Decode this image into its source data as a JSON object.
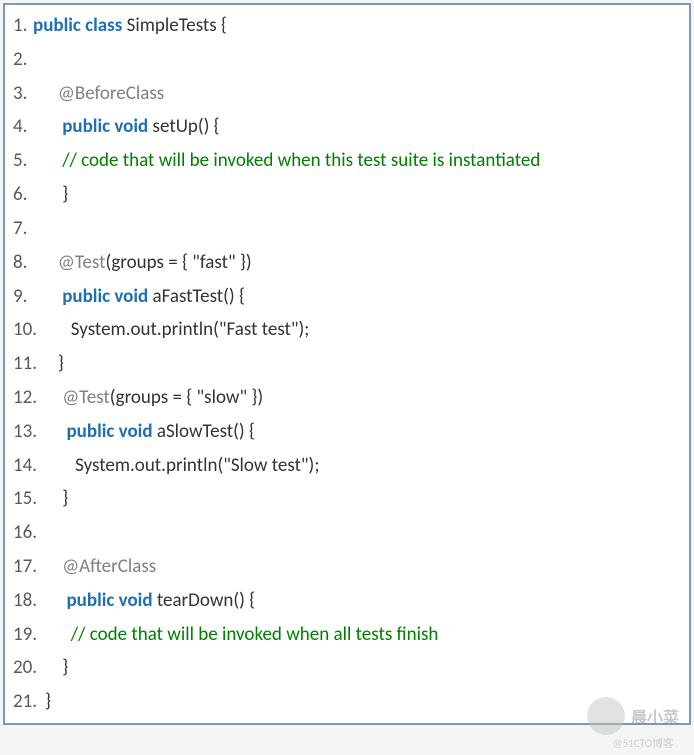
{
  "lines": [
    {
      "n": "1.",
      "indent": "",
      "segments": [
        {
          "t": "public class",
          "c": "kw"
        },
        {
          "t": " ",
          "c": "plain"
        },
        {
          "t": "SimpleTests {",
          "c": "cls"
        }
      ]
    },
    {
      "n": "2.",
      "indent": "",
      "segments": []
    },
    {
      "n": "3.",
      "indent": "   ",
      "segments": [
        {
          "t": "@BeforeClass",
          "c": "ann"
        }
      ]
    },
    {
      "n": "4.",
      "indent": "    ",
      "segments": [
        {
          "t": "public void",
          "c": "kw"
        },
        {
          "t": " setUp() {",
          "c": "plain"
        }
      ]
    },
    {
      "n": "5.",
      "indent": "    ",
      "segments": [
        {
          "t": "// code that will be invoked when this test suite is instantiated",
          "c": "comment"
        }
      ]
    },
    {
      "n": "6.",
      "indent": "    ",
      "segments": [
        {
          "t": "}",
          "c": "plain"
        }
      ]
    },
    {
      "n": "7.",
      "indent": "",
      "segments": []
    },
    {
      "n": "8.",
      "indent": "   ",
      "segments": [
        {
          "t": "@Test",
          "c": "ann"
        },
        {
          "t": "(groups = { \"fast\" })",
          "c": "plain"
        }
      ]
    },
    {
      "n": "9.",
      "indent": "    ",
      "segments": [
        {
          "t": "public void",
          "c": "kw"
        },
        {
          "t": " aFastTest() {",
          "c": "plain"
        }
      ]
    },
    {
      "n": "10.",
      "indent": "      ",
      "segments": [
        {
          "t": "System.out.println(\"Fast test\");",
          "c": "plain"
        }
      ]
    },
    {
      "n": "11.",
      "indent": "   ",
      "segments": [
        {
          "t": "}",
          "c": "plain"
        }
      ]
    },
    {
      "n": "12.",
      "indent": "    ",
      "segments": [
        {
          "t": "@Test",
          "c": "ann"
        },
        {
          "t": "(groups = { \"slow\" })",
          "c": "plain"
        }
      ]
    },
    {
      "n": "13.",
      "indent": "     ",
      "segments": [
        {
          "t": "public void",
          "c": "kw"
        },
        {
          "t": " aSlowTest() {",
          "c": "plain"
        }
      ]
    },
    {
      "n": "14.",
      "indent": "       ",
      "segments": [
        {
          "t": "System.out.println(\"Slow test\");",
          "c": "plain"
        }
      ]
    },
    {
      "n": "15.",
      "indent": "    ",
      "segments": [
        {
          "t": "}",
          "c": "plain"
        }
      ]
    },
    {
      "n": "16.",
      "indent": "",
      "segments": []
    },
    {
      "n": "17.",
      "indent": "    ",
      "segments": [
        {
          "t": "@AfterClass",
          "c": "ann"
        }
      ]
    },
    {
      "n": "18.",
      "indent": "     ",
      "segments": [
        {
          "t": "public void",
          "c": "kw"
        },
        {
          "t": " tearDown() {",
          "c": "plain"
        }
      ]
    },
    {
      "n": "19.",
      "indent": "      ",
      "segments": [
        {
          "t": "// code that will be invoked when all tests finish",
          "c": "comment"
        }
      ]
    },
    {
      "n": "20.",
      "indent": "    ",
      "segments": [
        {
          "t": "}",
          "c": "plain"
        }
      ]
    },
    {
      "n": "21.",
      "indent": "",
      "segments": [
        {
          "t": "}",
          "c": "plain"
        }
      ]
    }
  ],
  "watermark": {
    "text": "晨小菜",
    "sub": "@51CTO博客"
  }
}
